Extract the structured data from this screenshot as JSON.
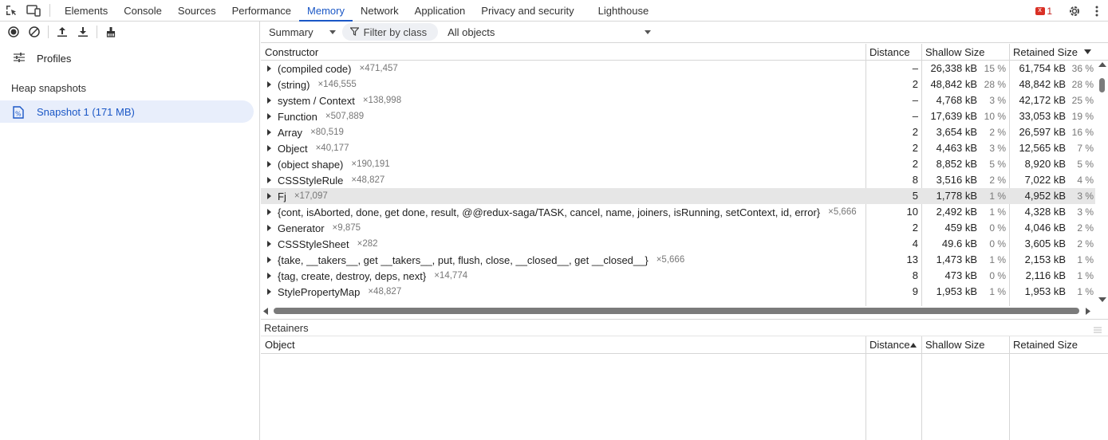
{
  "topbar": {
    "tabs": [
      "Elements",
      "Console",
      "Sources",
      "Performance",
      "Memory",
      "Network",
      "Application",
      "Privacy and security",
      "Lighthouse"
    ],
    "active_tab": "Memory",
    "issues_count": "1"
  },
  "sidebar": {
    "profiles_label": "Profiles",
    "heap_snapshots_title": "Heap snapshots",
    "snapshot_label": "Snapshot 1 (171 MB)"
  },
  "toolbar": {
    "view_select": "Summary",
    "filter_label": "Filter by class",
    "objects_select": "All objects"
  },
  "grid": {
    "headers": {
      "constructor": "Constructor",
      "distance": "Distance",
      "shallow": "Shallow Size",
      "retained": "Retained Size"
    },
    "rows": [
      {
        "name": "(compiled code)",
        "count": "×471,457",
        "distance": "–",
        "shallow": "26,338 kB",
        "shallow_pct": "15 %",
        "retained": "61,754 kB",
        "retained_pct": "36 %"
      },
      {
        "name": "(string)",
        "count": "×146,555",
        "distance": "2",
        "shallow": "48,842 kB",
        "shallow_pct": "28 %",
        "retained": "48,842 kB",
        "retained_pct": "28 %"
      },
      {
        "name": "system / Context",
        "count": "×138,998",
        "distance": "–",
        "shallow": "4,768 kB",
        "shallow_pct": "3 %",
        "retained": "42,172 kB",
        "retained_pct": "25 %"
      },
      {
        "name": "Function",
        "count": "×507,889",
        "distance": "–",
        "shallow": "17,639 kB",
        "shallow_pct": "10 %",
        "retained": "33,053 kB",
        "retained_pct": "19 %"
      },
      {
        "name": "Array",
        "count": "×80,519",
        "distance": "2",
        "shallow": "3,654 kB",
        "shallow_pct": "2 %",
        "retained": "26,597 kB",
        "retained_pct": "16 %"
      },
      {
        "name": "Object",
        "count": "×40,177",
        "distance": "2",
        "shallow": "4,463 kB",
        "shallow_pct": "3 %",
        "retained": "12,565 kB",
        "retained_pct": "7 %"
      },
      {
        "name": "(object shape)",
        "count": "×190,191",
        "distance": "2",
        "shallow": "8,852 kB",
        "shallow_pct": "5 %",
        "retained": "8,920 kB",
        "retained_pct": "5 %"
      },
      {
        "name": "CSSStyleRule",
        "count": "×48,827",
        "distance": "8",
        "shallow": "3,516 kB",
        "shallow_pct": "2 %",
        "retained": "7,022 kB",
        "retained_pct": "4 %"
      },
      {
        "name": "Fj",
        "count": "×17,097",
        "distance": "5",
        "shallow": "1,778 kB",
        "shallow_pct": "1 %",
        "retained": "4,952 kB",
        "retained_pct": "3 %",
        "selected": true
      },
      {
        "name": "{cont, isAborted, done, get done, result, @@redux-saga/TASK, cancel, name, joiners, isRunning, setContext, id, error}",
        "count": "×5,666",
        "distance": "10",
        "shallow": "2,492 kB",
        "shallow_pct": "1 %",
        "retained": "4,328 kB",
        "retained_pct": "3 %"
      },
      {
        "name": "Generator",
        "count": "×9,875",
        "distance": "2",
        "shallow": "459 kB",
        "shallow_pct": "0 %",
        "retained": "4,046 kB",
        "retained_pct": "2 %"
      },
      {
        "name": "CSSStyleSheet",
        "count": "×282",
        "distance": "4",
        "shallow": "49.6 kB",
        "shallow_pct": "0 %",
        "retained": "3,605 kB",
        "retained_pct": "2 %"
      },
      {
        "name": "{take, __takers__, get __takers__, put, flush, close, __closed__, get __closed__}",
        "count": "×5,666",
        "distance": "13",
        "shallow": "1,473 kB",
        "shallow_pct": "1 %",
        "retained": "2,153 kB",
        "retained_pct": "1 %"
      },
      {
        "name": "{tag, create, destroy, deps, next}",
        "count": "×14,774",
        "distance": "8",
        "shallow": "473 kB",
        "shallow_pct": "0 %",
        "retained": "2,116 kB",
        "retained_pct": "1 %"
      },
      {
        "name": "StylePropertyMap",
        "count": "×48,827",
        "distance": "9",
        "shallow": "1,953 kB",
        "shallow_pct": "1 %",
        "retained": "1,953 kB",
        "retained_pct": "1 %"
      }
    ]
  },
  "retainers": {
    "title": "Retainers",
    "headers": {
      "object": "Object",
      "distance": "Distance",
      "shallow": "Shallow Size",
      "retained": "Retained Size"
    }
  }
}
